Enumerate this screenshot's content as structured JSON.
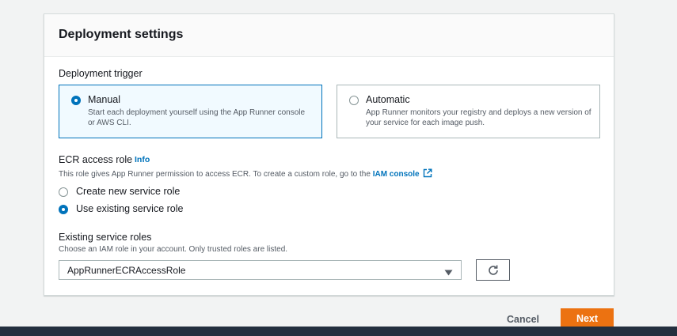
{
  "panel": {
    "title": "Deployment settings"
  },
  "deployment_trigger": {
    "label": "Deployment trigger",
    "options": [
      {
        "title": "Manual",
        "description": "Start each deployment yourself using the App Runner console or AWS CLI.",
        "selected": true
      },
      {
        "title": "Automatic",
        "description": "App Runner monitors your registry and deploys a new version of your service for each image push.",
        "selected": false
      }
    ]
  },
  "ecr_access_role": {
    "label": "ECR access role",
    "info_link": "Info",
    "description": "This role gives App Runner permission to access ECR. To create a custom role, go to the",
    "iam_link": "IAM console",
    "options": [
      {
        "label": "Create new service role",
        "selected": false
      },
      {
        "label": "Use existing service role",
        "selected": true
      }
    ]
  },
  "existing_roles": {
    "label": "Existing service roles",
    "description": "Choose an IAM role in your account. Only trusted roles are listed.",
    "selected_value": "AppRunnerECRAccessRole"
  },
  "footer": {
    "cancel_label": "Cancel",
    "next_label": "Next"
  },
  "icons": {
    "external_link": "external-link-icon",
    "caret": "caret-down-icon",
    "refresh": "refresh-icon"
  },
  "colors": {
    "accent": "#0073bb",
    "primary_button": "#ec7211",
    "bottom_bar": "#232f3e"
  }
}
